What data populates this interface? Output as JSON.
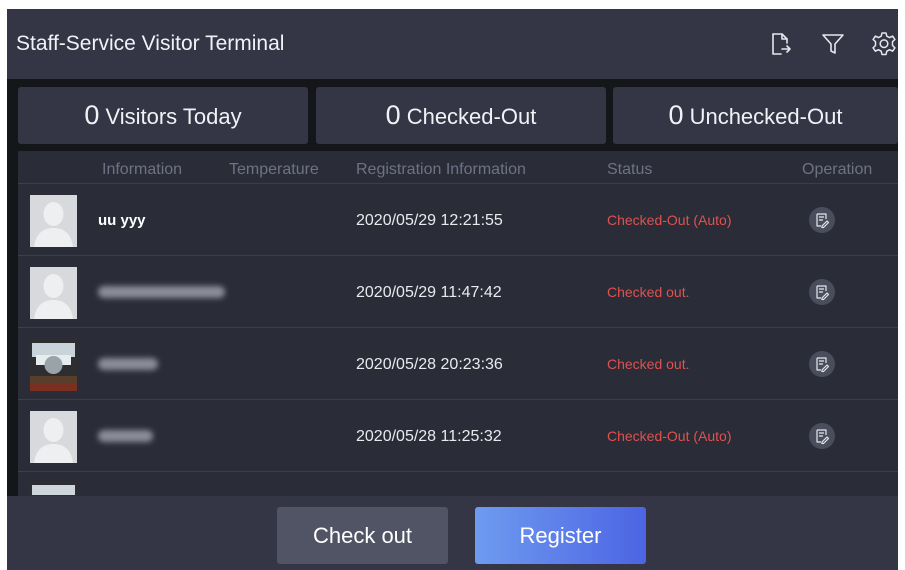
{
  "header": {
    "title": "Staff-Service Visitor Terminal",
    "icons": [
      "export-icon",
      "filter-icon",
      "settings-gear-icon"
    ]
  },
  "stats": [
    {
      "value": "0",
      "label": "Visitors Today"
    },
    {
      "value": "0",
      "label": "Checked-Out"
    },
    {
      "value": "0",
      "label": "Unchecked-Out"
    }
  ],
  "table": {
    "columns": [
      "Information",
      "Temperature",
      "Registration Information",
      "Status",
      "Operation"
    ],
    "rows": [
      {
        "name": "uu yyy",
        "registered": "2020/05/29 12:21:55",
        "status": "Checked-Out (Auto)"
      },
      {
        "name": "",
        "registered": "2020/05/29 11:47:42",
        "status": "Checked out."
      },
      {
        "name": "",
        "registered": "2020/05/28 20:23:36",
        "status": "Checked out."
      },
      {
        "name": "",
        "registered": "2020/05/28 11:25:32",
        "status": "Checked-Out (Auto)"
      }
    ]
  },
  "footer": {
    "checkout_label": "Check out",
    "register_label": "Register"
  },
  "colors": {
    "header_bg": "#343646",
    "table_bg": "#2a2c38",
    "status_red": "#e0514f",
    "register_gradient_start": "#6e9bf0",
    "register_gradient_end": "#4c64e3"
  }
}
